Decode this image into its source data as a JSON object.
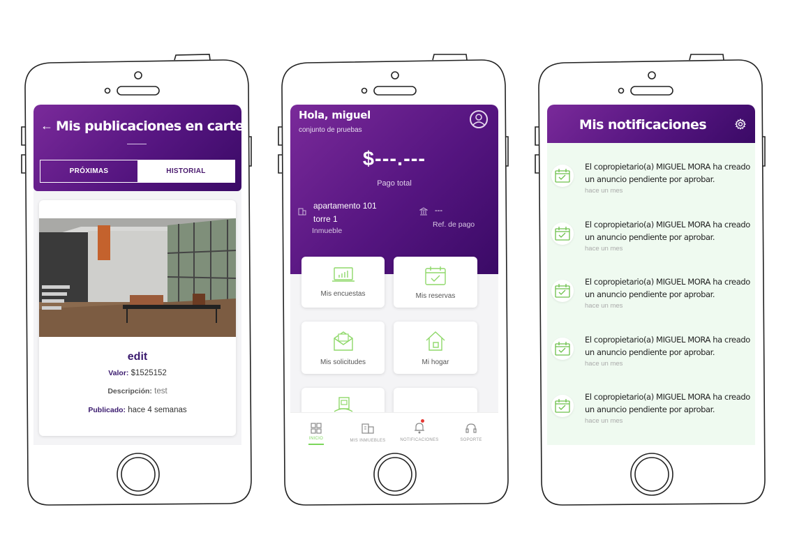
{
  "colors": {
    "brand_purple": "#5a1a85",
    "accent_green": "#7bd65a",
    "notif_bg": "#effaf0"
  },
  "screen1": {
    "back_icon": "arrow-left-icon",
    "title": "Mis publicaciones en cartelera",
    "tabs": [
      "PRÓXIMAS",
      "HISTORIAL"
    ],
    "card": {
      "name": "edit",
      "valor_label": "Valor:",
      "valor": "$1525152",
      "descripcion_label": "Descripción:",
      "descripcion": "test",
      "publicado_label": "Publicado:",
      "publicado": "hace 4 semanas"
    }
  },
  "screen2": {
    "greeting": "Hola, miguel",
    "conjunto": "conjunto de pruebas",
    "amount": "$---.---",
    "amount_label": "Pago total",
    "property_line1": "apartamento 101",
    "property_line2": "torre 1",
    "property_label": "Inmueble",
    "ref_value": "---",
    "ref_label": "Ref. de pago",
    "tiles": [
      "Mis encuestas",
      "Mis reservas",
      "Mis solicitudes",
      "Mi hogar"
    ],
    "nav": [
      "INICIO",
      "MIS INMUEBLES",
      "NOTIFICACIONES",
      "SOPORTE"
    ],
    "active_nav": "INICIO"
  },
  "screen3": {
    "title": "Mis notificaciones",
    "notifications": [
      {
        "text": "El copropietario(a) MIGUEL MORA ha creado un anuncio pendiente por aprobar.",
        "time": "hace un mes"
      },
      {
        "text": "El copropietario(a) MIGUEL MORA ha creado un anuncio pendiente por aprobar.",
        "time": "hace un mes"
      },
      {
        "text": "El copropietario(a) MIGUEL MORA ha creado un anuncio pendiente por aprobar.",
        "time": "hace un mes"
      },
      {
        "text": "El copropietario(a) MIGUEL MORA ha creado un anuncio pendiente por aprobar.",
        "time": "hace un mes"
      },
      {
        "text": "El copropietario(a) MIGUEL MORA ha creado un anuncio pendiente por aprobar.",
        "time": "hace un mes"
      }
    ]
  }
}
